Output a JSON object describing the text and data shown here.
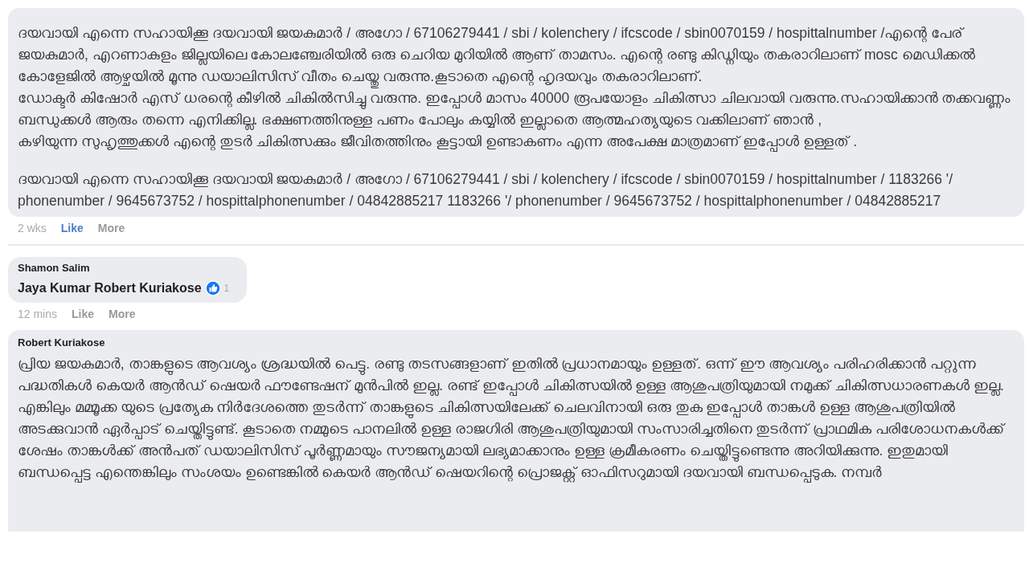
{
  "comments": [
    {
      "paragraphs": [
        "ദയവായി എന്നെ സഹായിക്കൂ ദയവായി ജയകുമാർ / അഗോ / 67106279441 / sbi / kolenchery / ifcscode / sbin0070159 / hospittalnumber /എന്റെ പേര് ജയകുമാർ, എറണാകുളം ജില്ലയിലെ കോലഞ്ചേരിയിൽ ഒരു ചെറിയ മുറിയിൽ ആണ് താമസം. എന്റെ രണ്ടു കിഡ്നിയും തകരാറിലാണ് mosc മെഡിക്കൽ കോളേജിൽ ആഴ്ചയിൽ മൂന്നു ഡയാലിസിസ് വീതം ചെയ്തു വരുന്നു.കൂടാതെ എന്റെ ഹൃദയവും തകരാറിലാണ്.",
        "ഡോക്ടർ കിഷോർ എസ് ധരന്റെ കീഴിൽ ചികിൽസിച്ചു വരുന്നു. ഇപ്പോൾ മാസം 40000 രൂപയോളം ചികിത്സാ ചിലവായി വരുന്നു.സഹായിക്കാൻ തക്കവണ്ണം ബന്ധുക്കൾ ആരും തന്നെ എനിക്കില്ല. ഭക്ഷണത്തിനുള്ള പണം പോലും കയ്യിൽ ഇല്ലാതെ ആത്മഹത്യയുടെ വക്കിലാണ് ഞാൻ ,",
        "കഴിയുന്ന സുഹൃത്തുക്കൾ എന്റെ തുടർ ചികിത്സക്കും ജീവിതത്തിനും കൂട്ടായി ഉണ്ടാകണം എന്ന അപേക്ഷ മാത്രമാണ് ഇപ്പോൾ ഉള്ളത് .",
        "ദയവായി എന്നെ സഹായിക്കൂ ദയവായി ജയകുമാർ / അഗോ / 67106279441 / sbi / kolenchery / ifcscode / sbin0070159 / hospittalnumber / 1183266 '/ phonenumber / 9645673752 / hospittalphonenumber / 04842885217 1183266 '/ phonenumber / 9645673752 / hospittalphonenumber / 04842885217"
      ],
      "time": "2 wks",
      "actions": [
        {
          "label": "Like",
          "selected": true
        },
        {
          "label": "More",
          "selected": false
        }
      ],
      "separated": true
    },
    {
      "author": "Shamon Salim",
      "mention": "Jaya Kumar Robert Kuriakose",
      "reaction": {
        "kind": "like",
        "count": "1"
      },
      "time": "12 mins",
      "actions": [
        {
          "label": "Like",
          "selected": false
        },
        {
          "label": "More",
          "selected": false
        }
      ],
      "separated": false
    },
    {
      "author": "Robert Kuriakose",
      "paragraphs": [
        "പ്രിയ ജയകുമാർ, താങ്കളുടെ ആവശ്യം ശ്രദ്ധയിൽ പെട്ടു. രണ്ടു തടസങ്ങളാണ് ഇതിൽ പ്രധാനമായും ഉള്ളത്. ഒന്ന് ഈ ആവശ്യം പരിഹരിക്കാൻ പറ്റുന്ന പദ്ധതികൾ കെയർ ആൻഡ് ഷെയർ ഫൗണ്ടേഷന് മുൻപിൽ ഇല്ല. രണ്ട് ഇപ്പോൾ ചികിത്സയിൽ ഉള്ള ആശുപത്രിയുമായി നമുക്ക് ചികിത്സധാരണകൾ ഇല്ല. എങ്കിലും മമ്മൂക്ക യുടെ പ്രത്യേക നിർദേശത്തെ തുടർന്ന് താങ്കളുടെ ചികിത്സയിലേക്ക് ചെലവിനായി ഒരു തുക ഇപ്പോൾ താങ്കൾ ഉള്ള ആശുപത്രിയിൽ അടക്കുവാൻ ഏർപ്പാട് ചെയ്തിട്ടുണ്ട്. കൂടാതെ നമ്മുടെ പാനലിൽ ഉള്ള രാജഗിരി ആശുപത്രിയുമായി സംസാരിച്ചതിനെ തുടർന്ന് പ്രാഥമിക പരിശോധനകൾക്ക് ശേഷം താങ്കൾക്ക് അൻപത് ഡയാലിസിസ് പൂർണ്ണമായും സൗജന്യമായി ലഭ്യമാക്കാനും ഉള്ള ക്രമീകരണം ചെയ്തിട്ടുണ്ടെന്നു അറിയിക്കുന്നു. ഇതുമായി ബന്ധപ്പെട്ട എന്തെങ്കിലും സംശയം ഉണ്ടെങ്കിൽ കെയർ ആൻഡ് ഷെയറിന്റെ പ്രൊജക്റ്റ് ഓഫിസറുമായി ദയവായി ബന്ധപ്പെടുക. നമ്പർ"
      ],
      "separated": false
    }
  ]
}
